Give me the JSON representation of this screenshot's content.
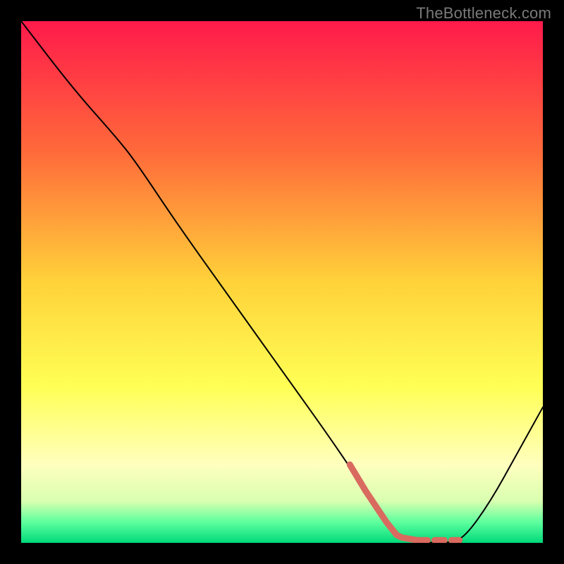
{
  "attribution": "TheBottleneck.com",
  "chart_data": {
    "type": "line",
    "title": "",
    "xlabel": "",
    "ylabel": "",
    "xlim": [
      0,
      100
    ],
    "ylim": [
      0,
      100
    ],
    "background_gradient": {
      "stops": [
        {
          "offset": 0,
          "color": "#ff1a4b"
        },
        {
          "offset": 25,
          "color": "#ff6a3a"
        },
        {
          "offset": 50,
          "color": "#ffd23a"
        },
        {
          "offset": 70,
          "color": "#ffff55"
        },
        {
          "offset": 85,
          "color": "#ffffbe"
        },
        {
          "offset": 92,
          "color": "#d9ffb0"
        },
        {
          "offset": 96,
          "color": "#5eff9e"
        },
        {
          "offset": 100,
          "color": "#00d97a"
        }
      ]
    },
    "series": [
      {
        "name": "bottleneck-curve",
        "stroke": "#000000",
        "stroke_width": 2,
        "dashed": false,
        "points": [
          {
            "x": 0,
            "y": 100
          },
          {
            "x": 10,
            "y": 87
          },
          {
            "x": 18,
            "y": 78
          },
          {
            "x": 22,
            "y": 73
          },
          {
            "x": 30,
            "y": 61
          },
          {
            "x": 40,
            "y": 47
          },
          {
            "x": 50,
            "y": 33
          },
          {
            "x": 60,
            "y": 19
          },
          {
            "x": 66,
            "y": 10
          },
          {
            "x": 70,
            "y": 4
          },
          {
            "x": 73,
            "y": 1
          },
          {
            "x": 78,
            "y": 0
          },
          {
            "x": 82,
            "y": 0
          },
          {
            "x": 85,
            "y": 1
          },
          {
            "x": 90,
            "y": 8
          },
          {
            "x": 95,
            "y": 17
          },
          {
            "x": 100,
            "y": 26
          }
        ]
      },
      {
        "name": "highlight-segment",
        "stroke": "#d96a5f",
        "stroke_width": 9,
        "dashed": false,
        "points": [
          {
            "x": 63,
            "y": 15
          },
          {
            "x": 66,
            "y": 10
          },
          {
            "x": 70,
            "y": 4
          },
          {
            "x": 72,
            "y": 1.5
          },
          {
            "x": 73,
            "y": 1
          },
          {
            "x": 76,
            "y": 0.5
          }
        ]
      },
      {
        "name": "highlight-dashed",
        "stroke": "#d96a5f",
        "stroke_width": 9,
        "dashed": true,
        "dash_pattern": "14 10",
        "points": [
          {
            "x": 76,
            "y": 0.5
          },
          {
            "x": 84,
            "y": 0.5
          }
        ]
      }
    ]
  }
}
